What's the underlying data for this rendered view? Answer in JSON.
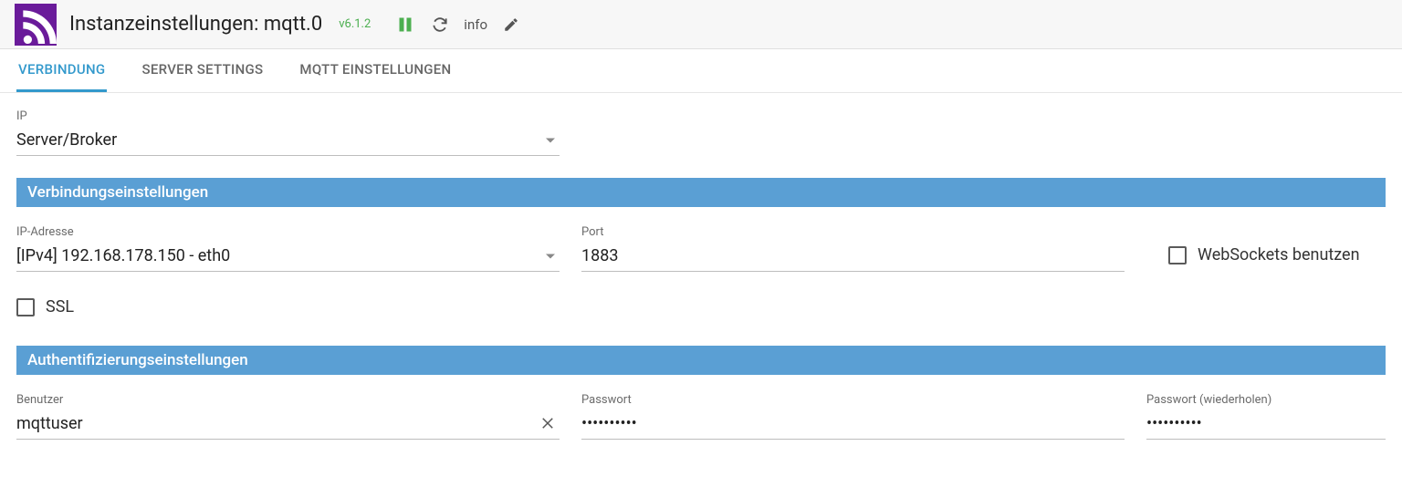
{
  "header": {
    "title": "Instanzeinstellungen: mqtt.0",
    "version": "v6.1.2",
    "info_label": "info"
  },
  "tabs": {
    "items": [
      {
        "label": "VERBINDUNG",
        "active": true
      },
      {
        "label": "SERVER SETTINGS",
        "active": false
      },
      {
        "label": "MQTT EINSTELLUNGEN",
        "active": false
      }
    ]
  },
  "ip_section": {
    "label": "IP",
    "value": "Server/Broker"
  },
  "connection_section": {
    "heading": "Verbindungseinstellungen",
    "ip_label": "IP-Adresse",
    "ip_value": "[IPv4] 192.168.178.150 - eth0",
    "port_label": "Port",
    "port_value": "1883",
    "websockets_label": "WebSockets benutzen",
    "websockets_checked": false,
    "ssl_label": "SSL",
    "ssl_checked": false
  },
  "auth_section": {
    "heading": "Authentifizierungseinstellungen",
    "user_label": "Benutzer",
    "user_value": "mqttuser",
    "password_label": "Passwort",
    "password_value": "••••••••••",
    "password_repeat_label": "Passwort (wiederholen)",
    "password_repeat_value": "••••••••••"
  },
  "colors": {
    "accent": "#3399cc",
    "section_bar": "#5a9fd4",
    "brand": "#6a1b9a",
    "version": "#4caf50"
  }
}
